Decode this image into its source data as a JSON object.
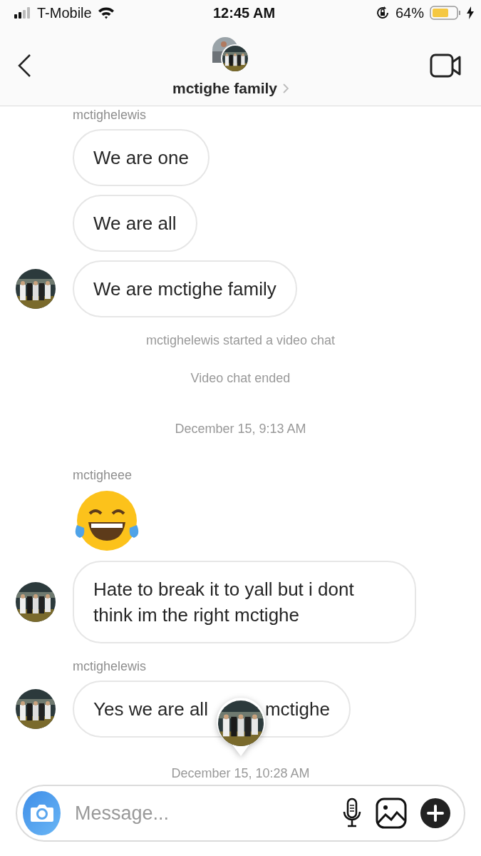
{
  "status_bar": {
    "carrier": "T-Mobile",
    "time": "12:45 AM",
    "battery": "64%"
  },
  "header": {
    "title": "mctighe family"
  },
  "messages": [
    {
      "kind": "sender",
      "text": "mctighelewis"
    },
    {
      "kind": "bubble",
      "parts": [
        "We are one"
      ],
      "avatar": false
    },
    {
      "kind": "bubble",
      "parts": [
        "We are all"
      ],
      "avatar": false
    },
    {
      "kind": "bubble",
      "parts": [
        "We are mctighe family"
      ],
      "avatar": true
    },
    {
      "kind": "event",
      "text": "mctighelewis started a video chat"
    },
    {
      "kind": "event",
      "text": "Video chat ended"
    },
    {
      "kind": "timestamp",
      "text": "December 15, 9:13 AM"
    },
    {
      "kind": "sender",
      "text": "mctigheee"
    },
    {
      "kind": "emoji"
    },
    {
      "kind": "bubble",
      "parts": [
        "Hate to break it to yall but i dont think im the right mctighe"
      ],
      "avatar": true
    },
    {
      "kind": "sender",
      "text": "mctighelewis"
    },
    {
      "kind": "bubble",
      "parts": [
        "Yes we are all",
        "mctighe"
      ],
      "avatar": true,
      "marker": true
    },
    {
      "kind": "timestamp",
      "text": "December 15, 10:28 AM"
    }
  ],
  "composer": {
    "placeholder": "Message..."
  }
}
